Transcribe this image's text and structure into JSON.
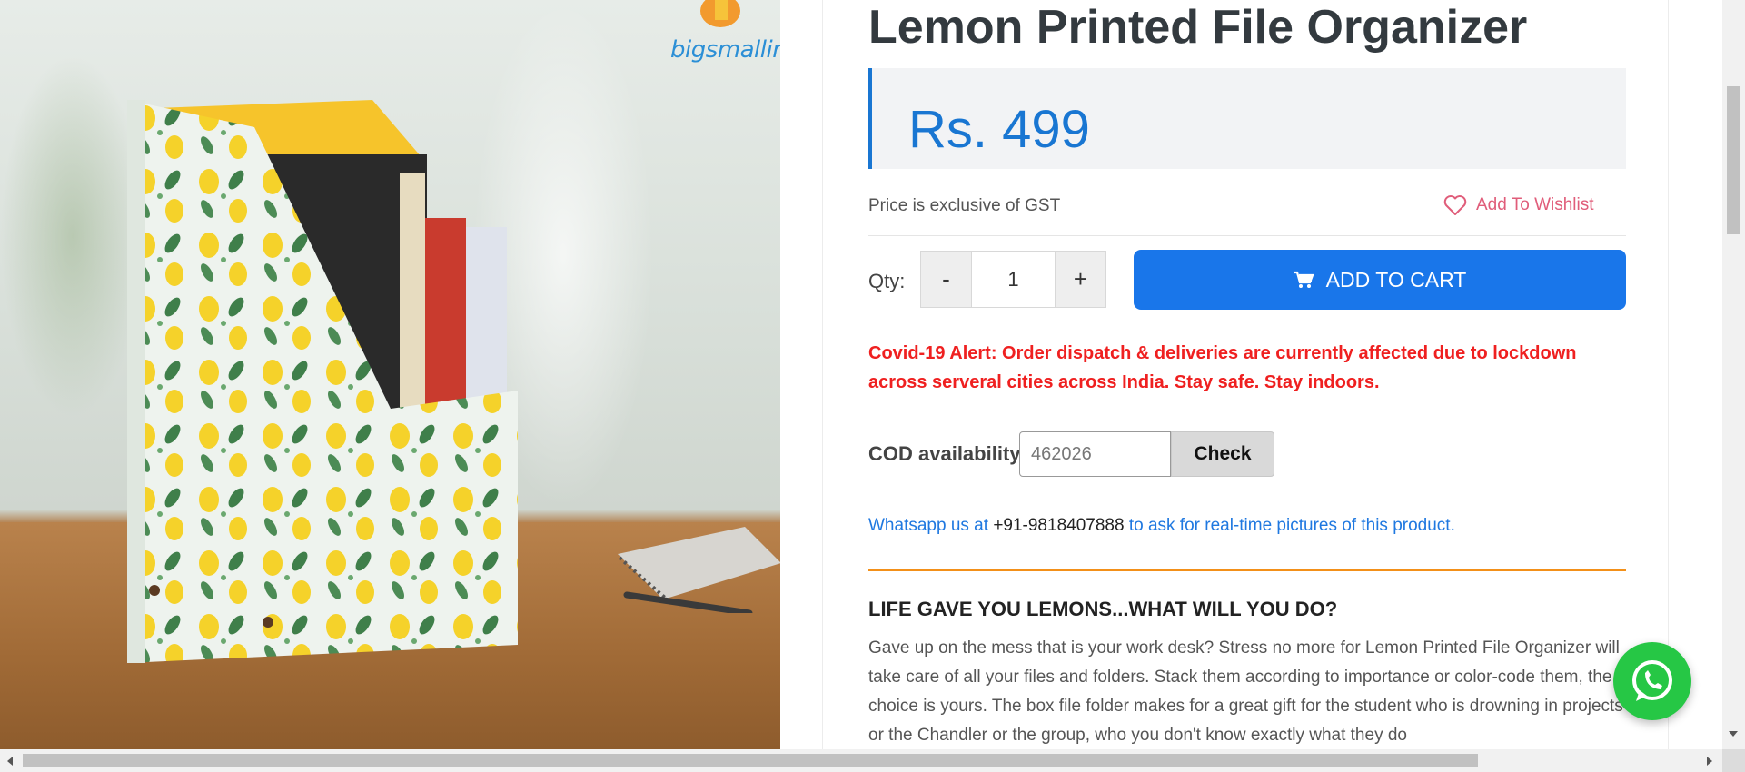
{
  "product": {
    "title": "Lemon Printed File Organizer",
    "price": "Rs. 499",
    "gst_note": "Price is exclusive of GST",
    "wishlist_label": "Add To Wishlist",
    "quantity_label": "Qty:",
    "quantity_value": "1",
    "decrement_label": "-",
    "increment_label": "+",
    "add_to_cart_label": "ADD TO CART"
  },
  "image": {
    "brand_logo_text": "bigsmallin",
    "icon": "product-photo"
  },
  "alert": {
    "text": "Covid-19 Alert: Order dispatch & deliveries are currently affected due to lockdown across serveral cities across India. Stay safe. Stay indoors."
  },
  "cod": {
    "label": "COD availability",
    "pincode_value": "462026",
    "check_label": "Check"
  },
  "whatsapp": {
    "prefix": "Whatsapp us at",
    "phone": "+91-9818407888",
    "suffix": "to ask for real-time pictures of this product."
  },
  "description": {
    "heading": "LIFE GAVE YOU LEMONS...WHAT WILL YOU DO?",
    "body": "Gave up on the mess that is your work desk? Stress no more for Lemon Printed File Organizer will take care of all your files and folders. Stack them according to importance or color-code them, the choice is yours. The box file folder makes for a great gift for the student who is drowning in projects or the Chandler or the group, who you don't know exactly what they do"
  },
  "colors": {
    "accent_blue": "#1976ea",
    "alert_red": "#ef2020",
    "wishlist_pink": "#e05d7a",
    "divider_orange": "#f39019",
    "whatsapp_green": "#26c745"
  }
}
